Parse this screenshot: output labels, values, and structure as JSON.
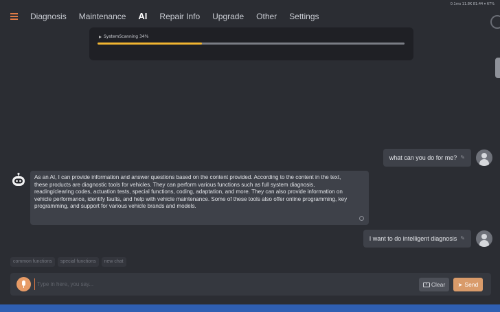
{
  "statusbar": {
    "text": "0.1ms 11.8K 81:44 ▾ 67%"
  },
  "nav": {
    "items": [
      {
        "label": "Diagnosis",
        "active": false
      },
      {
        "label": "Maintenance",
        "active": false
      },
      {
        "label": "AI",
        "active": true
      },
      {
        "label": "Repair Info",
        "active": false
      },
      {
        "label": "Upgrade",
        "active": false
      },
      {
        "label": "Other",
        "active": false
      },
      {
        "label": "Settings",
        "active": false
      }
    ]
  },
  "scan": {
    "label": "SystemScanning 34%",
    "progress": 0.34,
    "fill_color": "#f1b531"
  },
  "messages": [
    {
      "role": "user",
      "text": "what can you do for me?"
    },
    {
      "role": "bot",
      "text": "As an AI, I can provide information and answer questions based on the content provided. According to the content in the text, these products are diagnostic tools for vehicles. They can perform various functions such as full system diagnosis, reading/clearing codes, actuation tests, special functions, coding, adaptation, and more. They can also provide information on vehicle performance, identify faults, and help with vehicle maintenance. Some of these tools also offer online programming, key programming, and support for various vehicle brands and models."
    },
    {
      "role": "user",
      "text": "I want to do intelligent diagnosis"
    }
  ],
  "chips": [
    "common functions",
    "special functions",
    "new chat"
  ],
  "input": {
    "placeholder": "Type in here, you say...",
    "clear_label": "Clear",
    "send_label": "Send"
  },
  "colors": {
    "accent": "#e07a45",
    "send": "#d99b6a",
    "background": "#2b2d33",
    "bottom_strip": "#2f5fb2"
  }
}
